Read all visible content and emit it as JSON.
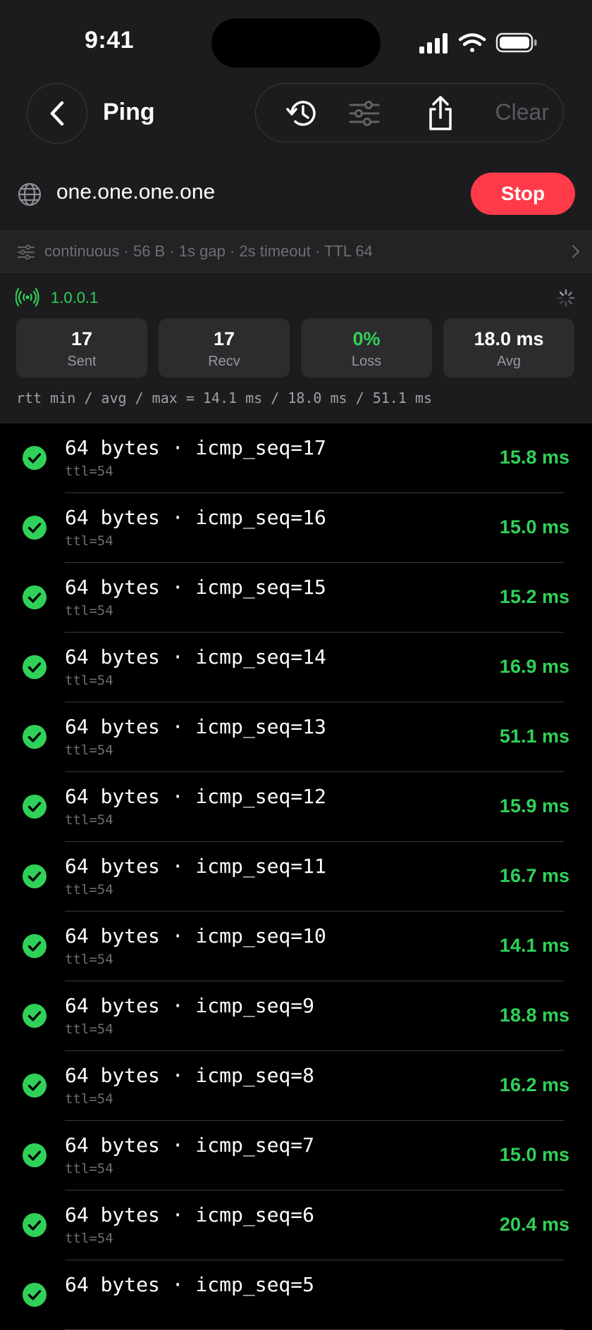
{
  "status_bar": {
    "time": "9:41"
  },
  "nav": {
    "title": "Ping",
    "clear_label": "Clear"
  },
  "host": {
    "value": "one.one.one.one",
    "stop_label": "Stop"
  },
  "options": {
    "summary": "continuous · 56 B · 1s gap · 2s timeout · TTL 64"
  },
  "resolved_ip": "1.0.0.1",
  "stats": [
    {
      "value": "17",
      "label": "Sent"
    },
    {
      "value": "17",
      "label": "Recv"
    },
    {
      "value": "0%",
      "label": "Loss"
    },
    {
      "value": "18.0 ms",
      "label": "Avg"
    }
  ],
  "rtt_summary": "rtt min / avg / max = 14.1 ms / 18.0 ms / 51.1 ms",
  "replies": [
    {
      "title": "64 bytes · icmp_seq=17",
      "ttl": "ttl=54",
      "time": "15.8 ms"
    },
    {
      "title": "64 bytes · icmp_seq=16",
      "ttl": "ttl=54",
      "time": "15.0 ms"
    },
    {
      "title": "64 bytes · icmp_seq=15",
      "ttl": "ttl=54",
      "time": "15.2 ms"
    },
    {
      "title": "64 bytes · icmp_seq=14",
      "ttl": "ttl=54",
      "time": "16.9 ms"
    },
    {
      "title": "64 bytes · icmp_seq=13",
      "ttl": "ttl=54",
      "time": "51.1 ms"
    },
    {
      "title": "64 bytes · icmp_seq=12",
      "ttl": "ttl=54",
      "time": "15.9 ms"
    },
    {
      "title": "64 bytes · icmp_seq=11",
      "ttl": "ttl=54",
      "time": "16.7 ms"
    },
    {
      "title": "64 bytes · icmp_seq=10",
      "ttl": "ttl=54",
      "time": "14.1 ms"
    },
    {
      "title": "64 bytes · icmp_seq=9",
      "ttl": "ttl=54",
      "time": "18.8 ms"
    },
    {
      "title": "64 bytes · icmp_seq=8",
      "ttl": "ttl=54",
      "time": "16.2 ms"
    },
    {
      "title": "64 bytes · icmp_seq=7",
      "ttl": "ttl=54",
      "time": "15.0 ms"
    },
    {
      "title": "64 bytes · icmp_seq=6",
      "ttl": "ttl=54",
      "time": "20.4 ms"
    },
    {
      "title": "64 bytes · icmp_seq=5",
      "ttl": "",
      "time": ""
    }
  ],
  "colors": {
    "accent_green": "#30d158",
    "stop_red": "#ff3b4a",
    "panel": "#1c1c1e"
  }
}
